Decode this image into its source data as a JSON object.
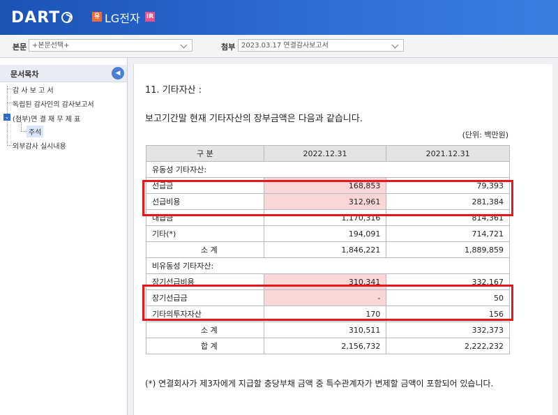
{
  "header": {
    "logo": "DART",
    "badge_left": "유",
    "company": "LG전자",
    "badge_right": "IR"
  },
  "toolbar": {
    "body_label": "본문",
    "body_select": "+본문선택+",
    "attach_label": "첨부",
    "attach_select": "2023.03.17  연결감사보고서"
  },
  "sidebar": {
    "title": "문서목차",
    "toggle_icon": "chevron-left-icon",
    "items": [
      {
        "label": "감 사 보 고 서"
      },
      {
        "label": "독립된 감사인의 감사보고서"
      },
      {
        "label": "(첨부)연 결 재 무 제 표"
      },
      {
        "label": "주석"
      },
      {
        "label": "외부감사 실시내용"
      }
    ]
  },
  "document": {
    "section_title": "11. 기타자산 :",
    "intro": "보고기간말 현재 기타자산의 장부금액은 다음과 같습니다.",
    "unit": "(단위: 백만원)",
    "table": {
      "headers": [
        "구 분",
        "2022.12.31",
        "2021.12.31"
      ],
      "group_current": "유동성 기타자산:",
      "current_rows": [
        {
          "label": "선급금",
          "v2022": "168,853",
          "v2021": "79,393"
        },
        {
          "label": "선급비용",
          "v2022": "312,961",
          "v2021": "281,384"
        },
        {
          "label": "대급금",
          "v2022": "1,170,316",
          "v2021": "814,361"
        },
        {
          "label": "기타(*)",
          "v2022": "194,091",
          "v2021": "714,721"
        }
      ],
      "current_subtotal": {
        "label": "소 계",
        "v2022": "1,846,221",
        "v2021": "1,889,859"
      },
      "group_noncurrent": "비유동성 기타자산:",
      "noncurrent_rows": [
        {
          "label": "장기선급비용",
          "v2022": "310,341",
          "v2021": "332,167"
        },
        {
          "label": "장기선급금",
          "v2022": "-",
          "v2021": "50"
        },
        {
          "label": "기타의투자자산",
          "v2022": "170",
          "v2021": "156"
        }
      ],
      "noncurrent_subtotal": {
        "label": "소 계",
        "v2022": "310,511",
        "v2021": "332,373"
      },
      "total": {
        "label": "합 계",
        "v2022": "2,156,732",
        "v2021": "2,222,232"
      }
    },
    "footnote": "(*) 연결회사가 제3자에게 지급할 충당부채 금액 중 특수관계자가 변제할 금액이 포함되어 있습니다."
  },
  "colors": {
    "header_blue": "#1b53b5",
    "highlight_fill": "#fbd6d6",
    "annotation_red": "#e8151b"
  }
}
